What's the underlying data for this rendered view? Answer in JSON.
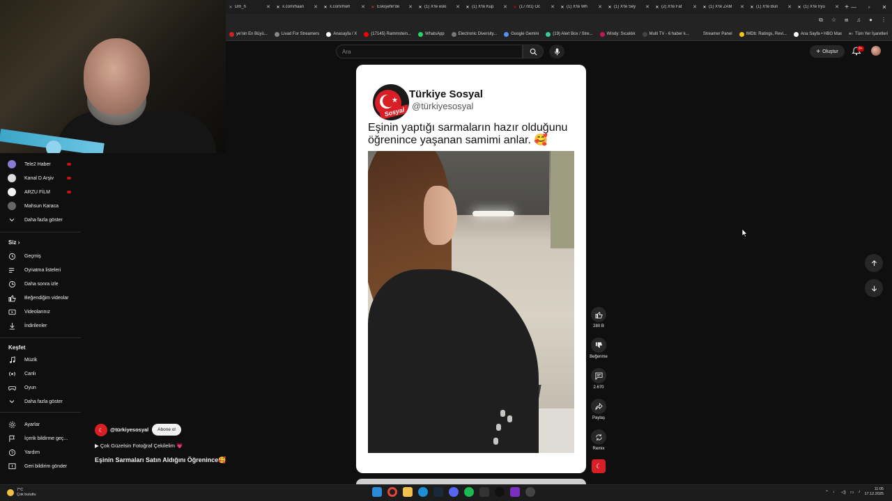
{
  "browser": {
    "tabs": [
      {
        "title": "Dm_h",
        "color": "#999999"
      },
      {
        "title": "x.com/haan",
        "color": "#ffffff"
      },
      {
        "title": "x.com/meh",
        "color": "#ffffff"
      },
      {
        "title": "Eskişehir'de",
        "color": "#e2453c"
      },
      {
        "title": "(1) X'te eski",
        "color": "#ffffff"
      },
      {
        "title": "(1) X'te Kup",
        "color": "#ffffff"
      },
      {
        "title": "(17781) Öc",
        "color": "#ff0000"
      },
      {
        "title": "(1) X'te Wh",
        "color": "#ffffff"
      },
      {
        "title": "(1) X'te Sey",
        "color": "#ffffff"
      },
      {
        "title": "(2) X'te Fat",
        "color": "#ffffff"
      },
      {
        "title": "(1) X'te ZAM",
        "color": "#ffffff"
      },
      {
        "title": "(1) X'te Bun",
        "color": "#ffffff"
      },
      {
        "title": "(1) X'te Iryu",
        "color": "#ffffff"
      }
    ],
    "new_tab": "+",
    "bookmarks": [
      {
        "label": "ye'nin En Büyü...",
        "color": "#cc2222"
      },
      {
        "label": "Livad For Streamers",
        "color": "#888888"
      },
      {
        "label": "Anasayfa / X",
        "color": "#ffffff"
      },
      {
        "label": "(17145) Rammstein...",
        "color": "#ff0000"
      },
      {
        "label": "WhatsApp",
        "color": "#25d366"
      },
      {
        "label": "Electronic Diversity...",
        "color": "#777777"
      },
      {
        "label": "Google Gemini",
        "color": "#5b8def"
      },
      {
        "label": "(19) Alert Box / Stre...",
        "color": "#33cc99"
      },
      {
        "label": "Windy: Sıcaklık",
        "color": "#c2185b"
      },
      {
        "label": "Multi TV - 6 haber k...",
        "color": "#444444"
      },
      {
        "label": "Streamer Panel",
        "color": "#222222"
      },
      {
        "label": "IMDb: Ratings, Revi...",
        "color": "#f5c518"
      },
      {
        "label": "Ana Sayfa • HBO Max",
        "color": "#ffffff"
      }
    ],
    "all_bookmarks": "Tüm Yer İşaretleri"
  },
  "header": {
    "search_placeholder": "Ara",
    "create_label": "Oluştur",
    "notif_count": "9+"
  },
  "sidebar": {
    "subscriptions": [
      {
        "label": "Tele2 Haber",
        "color": "#8a7cd6",
        "live": true
      },
      {
        "label": "Kanal D Arşiv",
        "color": "#dddddd",
        "live": true
      },
      {
        "label": "ARZU FİLM",
        "color": "#f2f2f2",
        "live": true
      },
      {
        "label": "Mahsun Karaca",
        "color": "#666666",
        "live": false
      }
    ],
    "show_more": "Daha fazla göster",
    "you_heading": "Siz",
    "you_items": [
      {
        "label": "Geçmiş",
        "icon": "history-icon"
      },
      {
        "label": "Oynatma listeleri",
        "icon": "playlist-icon"
      },
      {
        "label": "Daha sonra izle",
        "icon": "clock-icon"
      },
      {
        "label": "Beğendiğim videolar",
        "icon": "thumb-up-icon"
      },
      {
        "label": "Videolarınız",
        "icon": "video-icon"
      },
      {
        "label": "İndirilenler",
        "icon": "download-icon"
      }
    ],
    "explore_heading": "Keşfet",
    "explore_items": [
      {
        "label": "Müzik",
        "icon": "music-icon"
      },
      {
        "label": "Canlı",
        "icon": "live-icon"
      },
      {
        "label": "Oyun",
        "icon": "gaming-icon"
      }
    ],
    "explore_more": "Daha fazla göster",
    "bottom_items": [
      {
        "label": "Ayarlar",
        "icon": "gear-icon"
      },
      {
        "label": "İçerik bildirme geç...",
        "icon": "flag-icon"
      },
      {
        "label": "Yardım",
        "icon": "help-icon"
      },
      {
        "label": "Geri bildirim gönder",
        "icon": "feedback-icon"
      }
    ]
  },
  "short": {
    "account_name": "Türkiye Sosyal",
    "account_handle": "@türkiyesosyal",
    "logo_text": "Sosyal",
    "caption": "Eşinin yaptığı sarmaların hazır olduğunu öğrenince yaşanan samimi anlar. 🥰",
    "channel_handle": "@türkiyesosyal",
    "subscribe_label": "Abone ol",
    "sound": "▶ Çok Güzelsin Fotoğraf Çekilelim 💗",
    "title": "Eşinin Sarmaları Satın Aldığını Öğrenince🥰"
  },
  "actions": {
    "likes": "280 B",
    "dislike": "Beğenme",
    "comments": "2.670",
    "share": "Paylaş",
    "remix": "Remix"
  },
  "taskbar": {
    "temperature": "7°C",
    "weather": "Çok bulutlu",
    "time": "11:05",
    "date": "17.12.2025"
  }
}
